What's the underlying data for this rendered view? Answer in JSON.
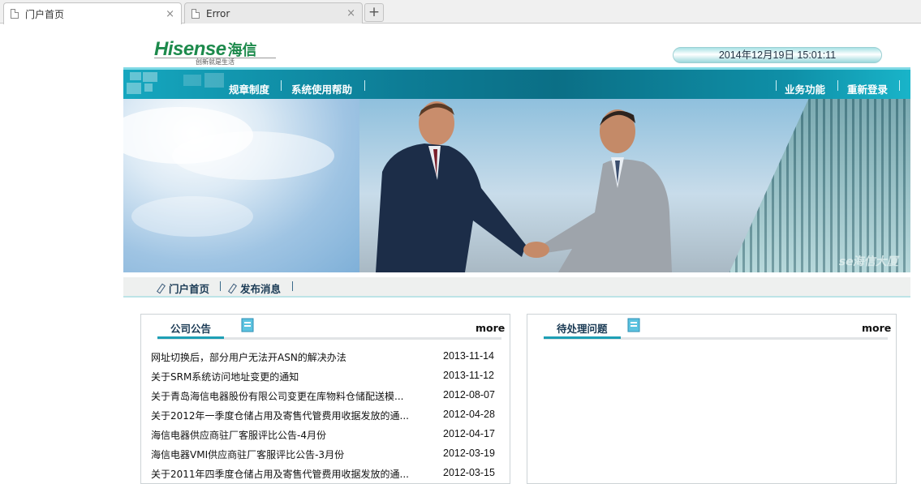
{
  "browser": {
    "tabs": [
      {
        "title": "门户首页",
        "active": true
      },
      {
        "title": "Error",
        "active": false
      }
    ],
    "close_glyph": "×",
    "new_tab_glyph": "+"
  },
  "header": {
    "logo_brand": "Hisense",
    "logo_cn": "海信",
    "logo_slogan": "创新就是生活",
    "datetime": "2014年12月19日 15:01:11"
  },
  "nav": {
    "left": [
      "规章制度",
      "系统使用帮助"
    ],
    "right": [
      "业务功能",
      "重新登录"
    ]
  },
  "banner": {
    "building_text": "se海信大厦"
  },
  "subnav": {
    "items": [
      "门户首页",
      "发布消息"
    ]
  },
  "panels": {
    "announcements": {
      "title": "公司公告",
      "more": "more",
      "rows": [
        {
          "title": "网址切换后，部分用户无法开ASN的解决办法",
          "date": "2013-11-14"
        },
        {
          "title": "关于SRM系统访问地址变更的通知",
          "date": "2013-11-12"
        },
        {
          "title": "关于青岛海信电器股份有限公司变更在库物料仓储配送模...",
          "date": "2012-08-07"
        },
        {
          "title": "关于2012年一季度仓储占用及寄售代管费用收据发放的通...",
          "date": "2012-04-28"
        },
        {
          "title": "海信电器供应商驻厂客服评比公告-4月份",
          "date": "2012-04-17"
        },
        {
          "title": "海信电器VMI供应商驻厂客服评比公告-3月份",
          "date": "2012-03-19"
        },
        {
          "title": "关于2011年四季度仓储占用及寄售代管费用收据发放的通...",
          "date": "2012-03-15"
        }
      ]
    },
    "pending": {
      "title": "待处理问题",
      "more": "more",
      "rows": []
    }
  },
  "colors": {
    "accent": "#1e9fb5",
    "nav_bg": "#0d7d96",
    "brand_green": "#1d8a4c"
  }
}
